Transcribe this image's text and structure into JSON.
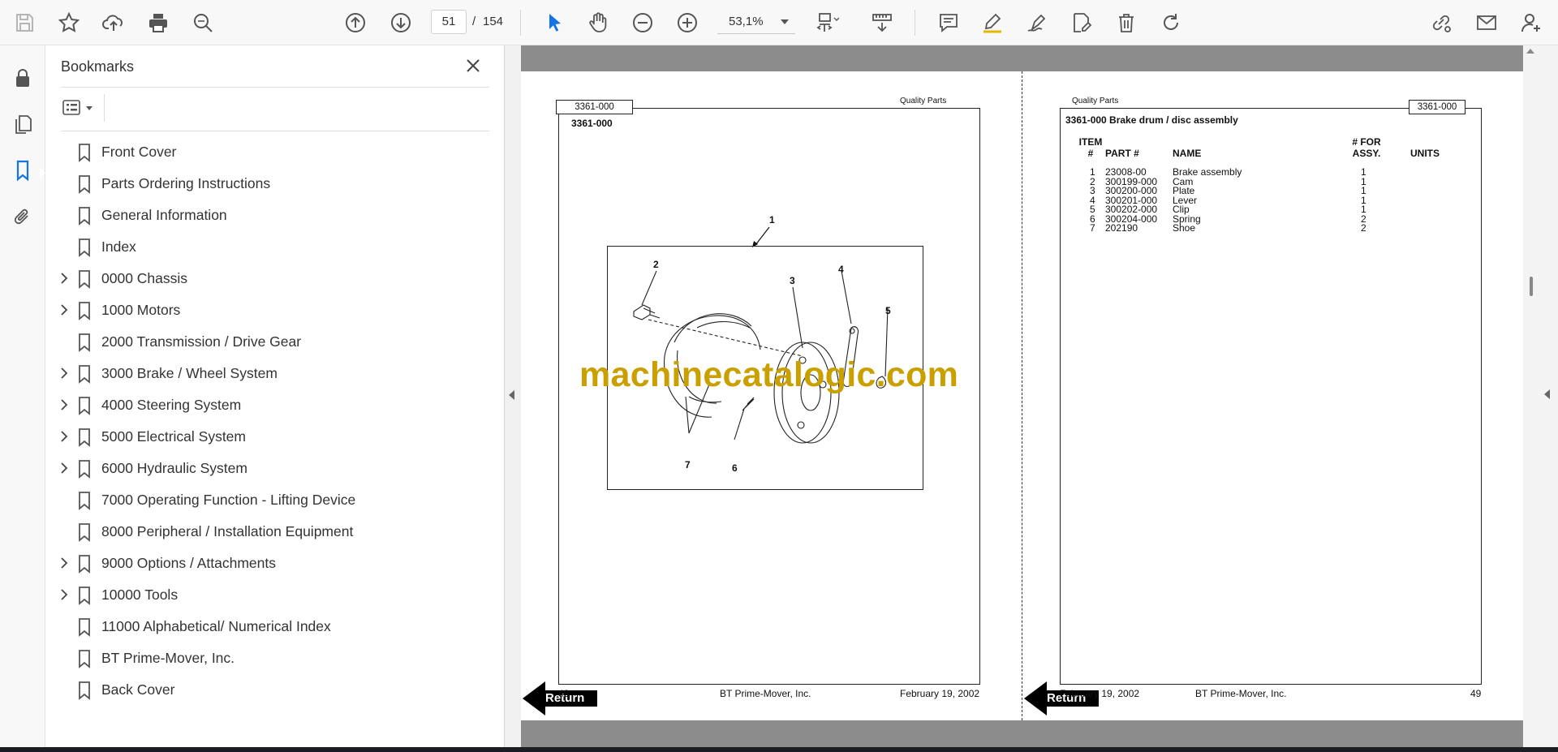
{
  "toolbar": {
    "current_page": "51",
    "page_separator": "/",
    "total_pages": "154",
    "zoom": "53,1%",
    "accent_color": "#1473e6"
  },
  "bookmarks": {
    "title": "Bookmarks",
    "items": [
      {
        "label": "Front Cover",
        "expandable": false
      },
      {
        "label": "Parts Ordering Instructions",
        "expandable": false
      },
      {
        "label": "General Information",
        "expandable": false
      },
      {
        "label": "Index",
        "expandable": false
      },
      {
        "label": "0000 Chassis",
        "expandable": true
      },
      {
        "label": "1000 Motors",
        "expandable": true
      },
      {
        "label": "2000 Transmission / Drive Gear",
        "expandable": false
      },
      {
        "label": "3000 Brake / Wheel System",
        "expandable": true
      },
      {
        "label": "4000 Steering System",
        "expandable": true
      },
      {
        "label": "5000 Electrical System",
        "expandable": true
      },
      {
        "label": "6000 Hydraulic System",
        "expandable": true
      },
      {
        "label": "7000 Operating Function - Lifting Device",
        "expandable": false
      },
      {
        "label": "8000 Peripheral / Installation Equipment",
        "expandable": false
      },
      {
        "label": "9000 Options / Attachments",
        "expandable": true
      },
      {
        "label": "10000 Tools",
        "expandable": true
      },
      {
        "label": "11000 Alphabetical/ Numerical Index",
        "expandable": false
      },
      {
        "label": "BT Prime-Mover, Inc.",
        "expandable": false
      },
      {
        "label": "Back Cover",
        "expandable": false
      }
    ]
  },
  "left_page": {
    "tag": "3361-000",
    "brand": "Quality Parts",
    "heading": "3361-000",
    "callouts": [
      "1",
      "2",
      "3",
      "4",
      "5",
      "6",
      "7"
    ],
    "watermark": "machinecatalogic.com",
    "footer_page": "48",
    "footer_company": "BT Prime-Mover, Inc.",
    "footer_date": "February 19, 2002",
    "return_label": "Return"
  },
  "right_page": {
    "tag": "3361-000",
    "brand": "Quality Parts",
    "title": "3361-000 Brake drum / disc assembly",
    "table": {
      "headers": {
        "item_line1": "ITEM",
        "item_line2": "#",
        "part": "PART #",
        "name": "NAME",
        "assy_line1": "# FOR",
        "assy_line2": "ASSY.",
        "units": "UNITS"
      },
      "rows": [
        {
          "item": "1",
          "part": "23008-00",
          "name": "Brake assembly",
          "qty": "1"
        },
        {
          "item": "2",
          "part": "300199-000",
          "name": "Cam",
          "qty": "1"
        },
        {
          "item": "3",
          "part": "300200-000",
          "name": "Plate",
          "qty": "1"
        },
        {
          "item": "4",
          "part": "300201-000",
          "name": "Lever",
          "qty": "1"
        },
        {
          "item": "5",
          "part": "300202-000",
          "name": "Clip",
          "qty": "1"
        },
        {
          "item": "6",
          "part": "300204-000",
          "name": "Spring",
          "qty": "2"
        },
        {
          "item": "7",
          "part": "202190",
          "name": "Shoe",
          "qty": "2"
        }
      ]
    },
    "footer_date": "February 19, 2002",
    "footer_company": "BT Prime-Mover, Inc.",
    "footer_page": "49",
    "return_label": "Return"
  }
}
